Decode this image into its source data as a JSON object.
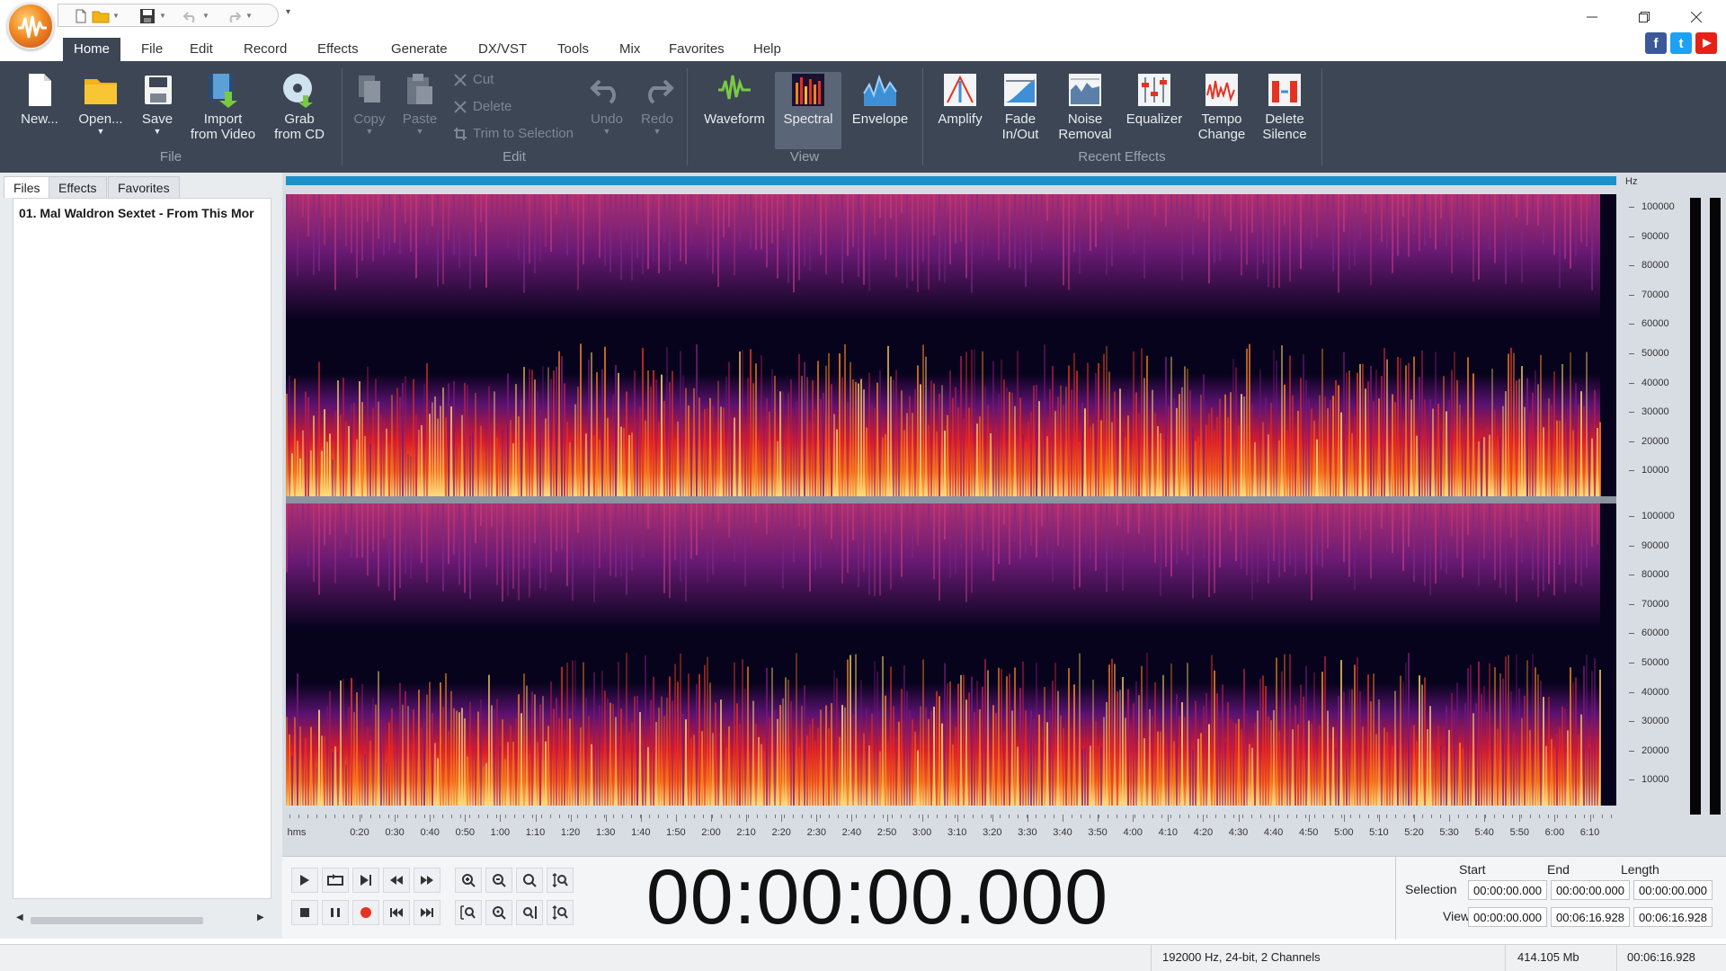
{
  "app": {
    "colors": {
      "ribbon": "#3c4654",
      "accent": "#1e90c8",
      "spectrum_bg": "#07031c",
      "facebook": "#3b5998",
      "twitter": "#1da1f2",
      "youtube": "#e62117"
    }
  },
  "menu": {
    "tabs": [
      {
        "label": "Home",
        "active": true
      },
      {
        "label": "File"
      },
      {
        "label": "Edit"
      },
      {
        "label": "Record"
      },
      {
        "label": "Effects"
      },
      {
        "label": "Generate"
      },
      {
        "label": "DX/VST"
      },
      {
        "label": "Tools"
      },
      {
        "label": "Mix"
      },
      {
        "label": "Favorites"
      },
      {
        "label": "Help"
      }
    ]
  },
  "ribbon": {
    "file_group": {
      "label": "File",
      "new": "New...",
      "open": "Open...",
      "save": "Save",
      "import_video": [
        "Import",
        "from Video"
      ],
      "grab_cd": [
        "Grab",
        "from CD"
      ]
    },
    "edit_group": {
      "label": "Edit",
      "copy": "Copy",
      "paste": "Paste",
      "cut": "Cut",
      "delete": "Delete",
      "trim": "Trim to Selection",
      "undo": "Undo",
      "redo": "Redo"
    },
    "view_group": {
      "label": "View",
      "waveform": "Waveform",
      "spectral": "Spectral",
      "envelope": "Envelope"
    },
    "recent_group": {
      "label": "Recent Effects",
      "amplify": "Amplify",
      "fade": [
        "Fade",
        "In/Out"
      ],
      "noise": [
        "Noise",
        "Removal"
      ],
      "equalizer": "Equalizer",
      "tempo": [
        "Tempo",
        "Change"
      ],
      "silence": [
        "Delete",
        "Silence"
      ]
    }
  },
  "left_panel": {
    "tabs": [
      "Files",
      "Effects",
      "Favorites"
    ],
    "file_item": "01. Mal Waldron Sextet - From This Mor"
  },
  "hz_axis": {
    "unit": "Hz",
    "labels": [
      "100000",
      "90000",
      "80000",
      "70000",
      "60000",
      "50000",
      "40000",
      "30000",
      "20000",
      "10000"
    ]
  },
  "time_axis": {
    "unit": "hms",
    "labels": [
      "0:20",
      "0:30",
      "0:40",
      "0:50",
      "1:00",
      "1:10",
      "1:20",
      "1:30",
      "1:40",
      "1:50",
      "2:00",
      "2:10",
      "2:20",
      "2:30",
      "2:40",
      "2:50",
      "3:00",
      "3:10",
      "3:20",
      "3:30",
      "3:40",
      "3:50",
      "4:00",
      "4:10",
      "4:20",
      "4:30",
      "4:40",
      "4:50",
      "5:00",
      "5:10",
      "5:20",
      "5:30",
      "5:40",
      "5:50",
      "6:00",
      "6:10"
    ]
  },
  "transport": {
    "timer": "00:00:00.000"
  },
  "selection": {
    "headers": [
      "Start",
      "End",
      "Length"
    ],
    "selection_label": "Selection",
    "view_label": "View",
    "selection_values": [
      "00:00:00.000",
      "00:00:00.000",
      "00:00:00.000"
    ],
    "view_values": [
      "00:00:00.000",
      "00:06:16.928",
      "00:06:16.928"
    ]
  },
  "status": {
    "format": "192000 Hz, 24-bit, 2 Channels",
    "size": "414.105 Mb",
    "duration": "00:06:16.928"
  }
}
